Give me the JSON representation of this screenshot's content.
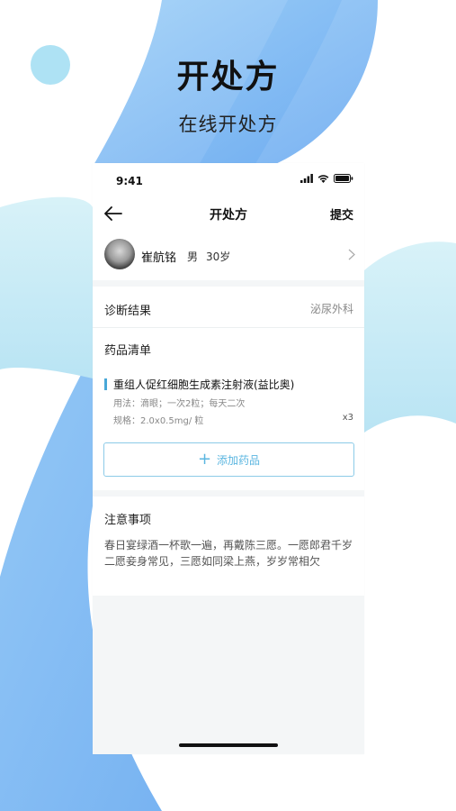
{
  "hero": {
    "title": "开处方",
    "subtitle": "在线开处方"
  },
  "colors": {
    "accent": "#48a8d8",
    "background_blue": "#7fb8f4",
    "background_light": "#bfe6f4"
  },
  "status_bar": {
    "time": "9:41",
    "icons": [
      "signal-icon",
      "wifi-icon",
      "battery-icon"
    ]
  },
  "nav": {
    "back_icon": "arrow-left-icon",
    "title": "开处方",
    "submit_label": "提交"
  },
  "patient": {
    "name": "崔航铭",
    "gender": "男",
    "age": "30岁",
    "chevron_icon": "chevron-right-icon"
  },
  "diagnosis": {
    "label": "诊断结果",
    "value": "泌尿外科"
  },
  "drugs": {
    "header": "药品清单",
    "items": [
      {
        "name": "重组人促红细胞生成素注射液(益比奥)",
        "usage": "用法：滴眼；一次2粒；每天二次",
        "spec": "规格：2.0x0.5mg/ 粒",
        "qty": "x3"
      }
    ],
    "add_icon": "plus-icon",
    "add_label": "添加药品"
  },
  "notes": {
    "header": "注意事项",
    "text": "春日宴绿酒一杯歌一遍，再戴陈三愿。一愿郎君千岁二愿妾身常见，三愿如同梁上燕，岁岁常相欠"
  }
}
